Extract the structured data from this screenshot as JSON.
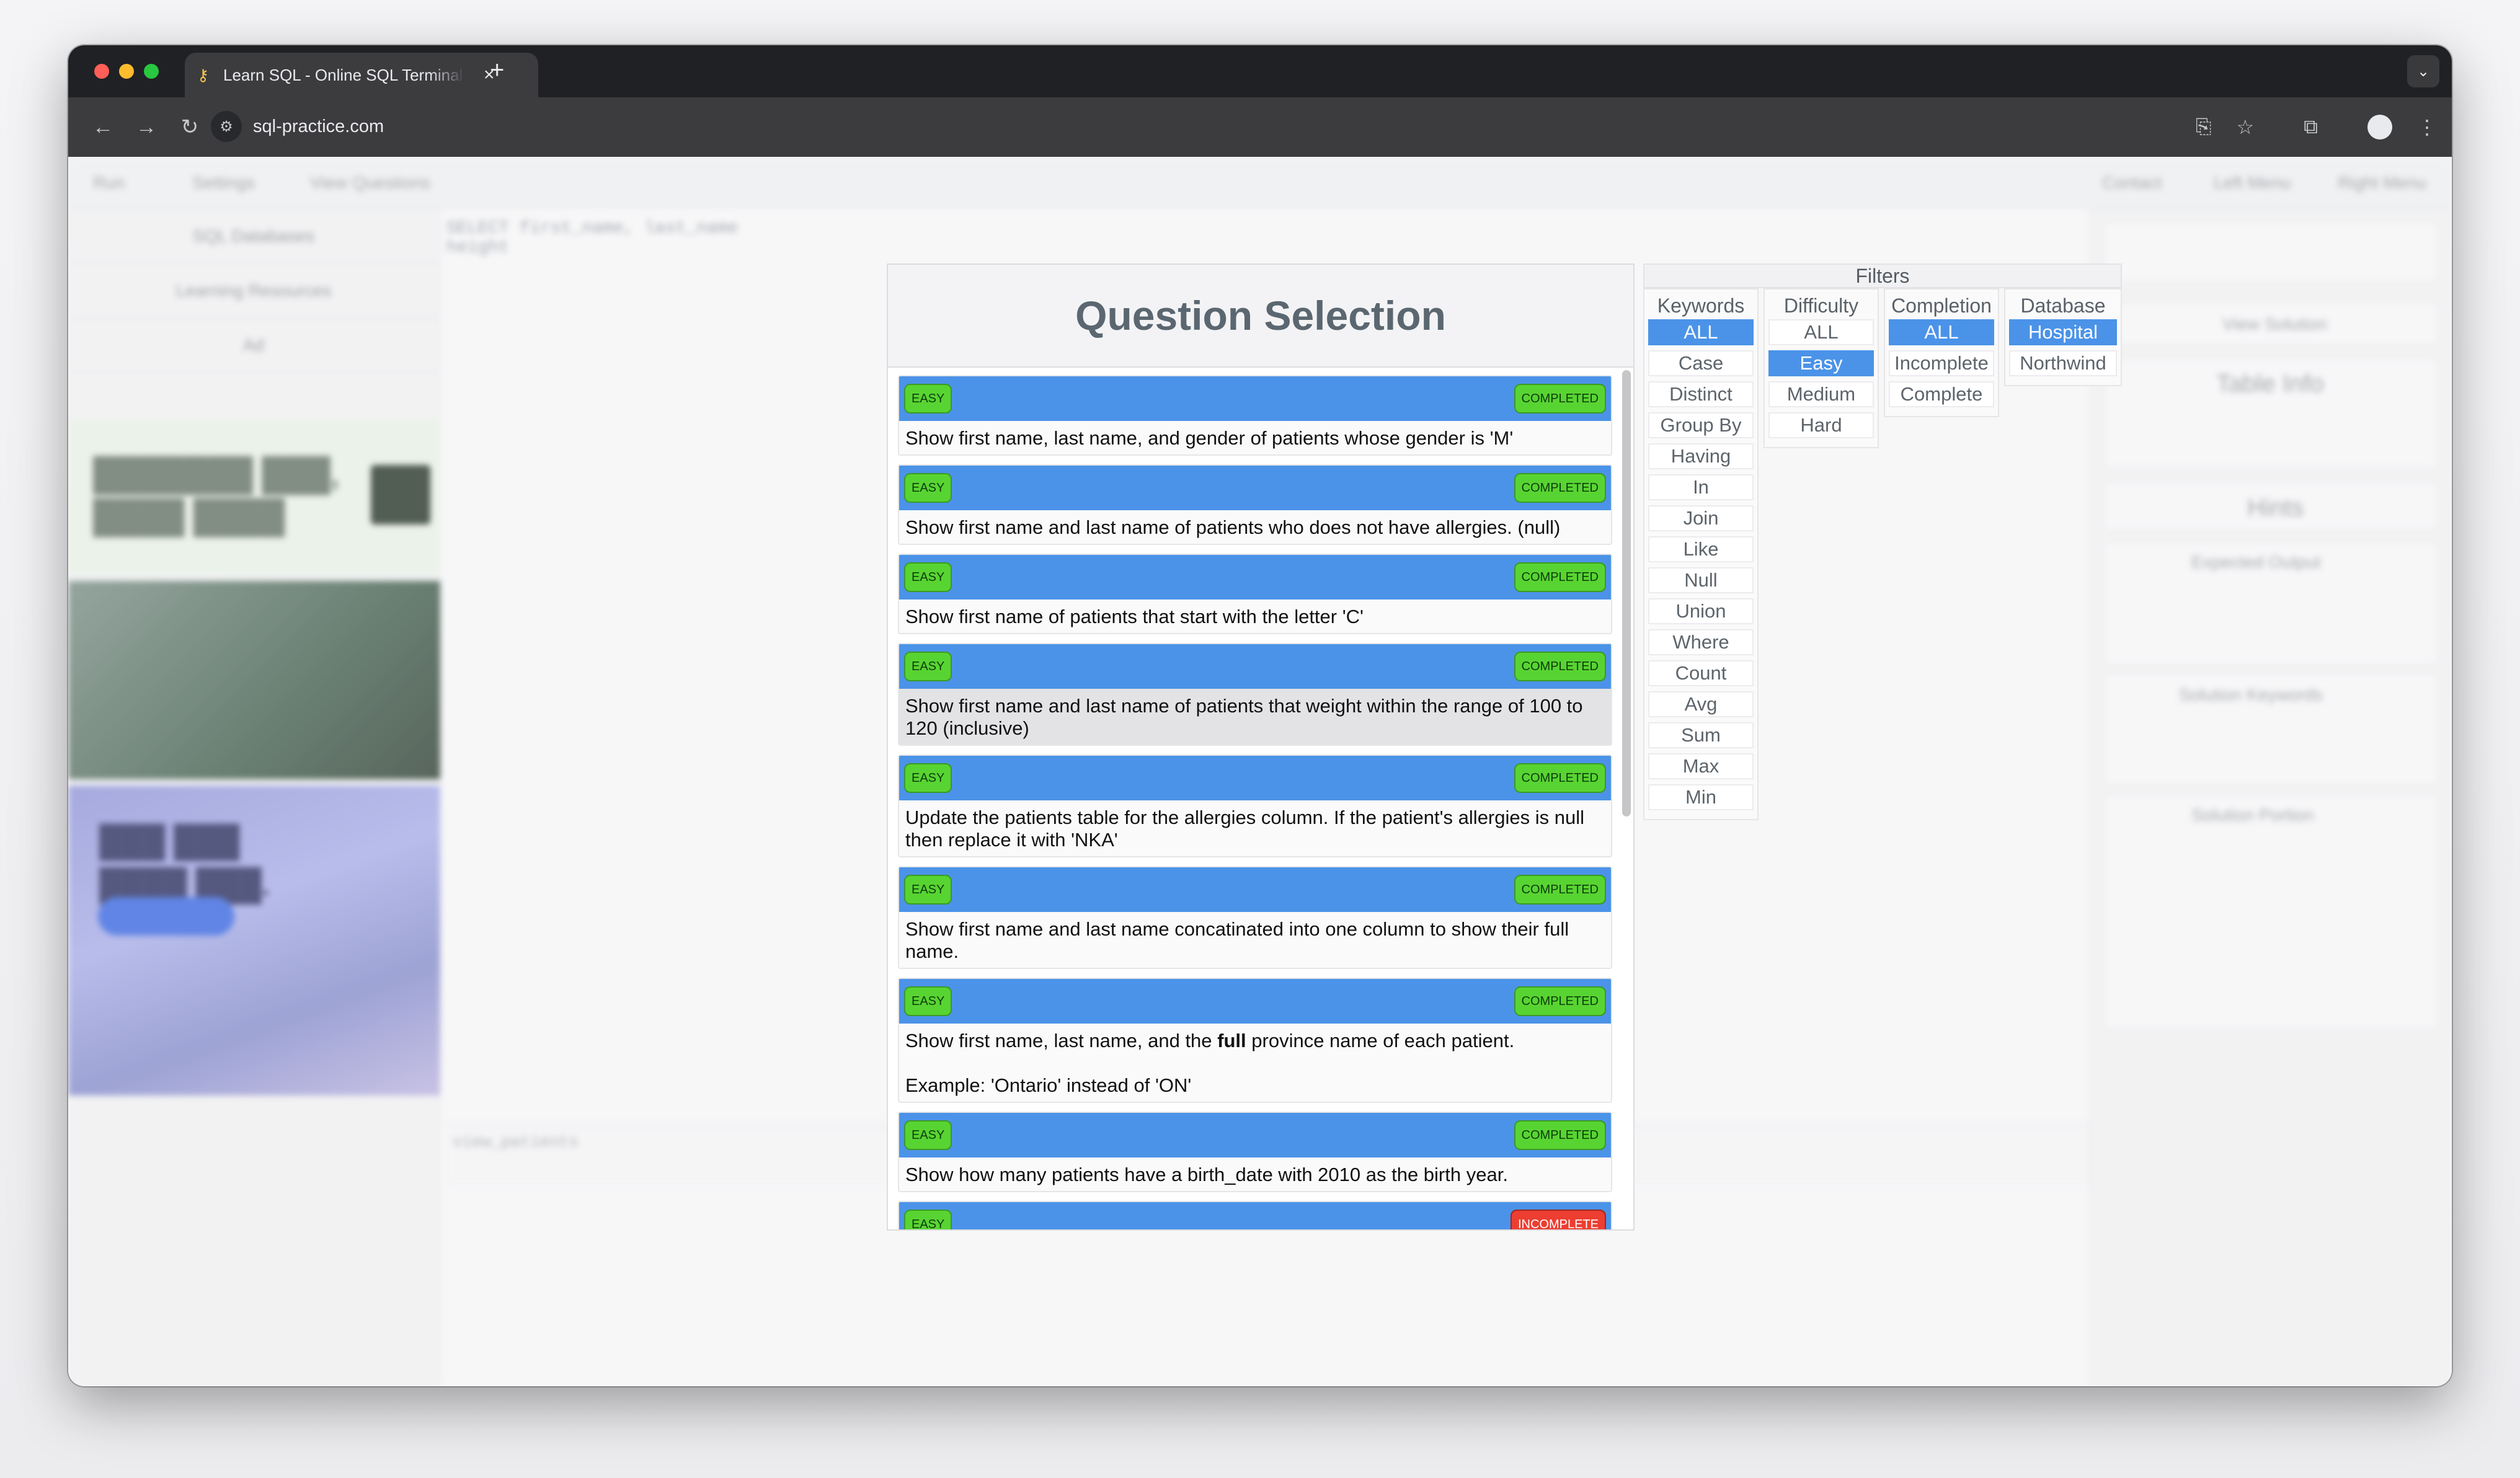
{
  "browser": {
    "tab_title": "Learn SQL - Online SQL Terminal",
    "url": "sql-practice.com",
    "new_tab_label": "+",
    "close_tab_label": "×"
  },
  "modal": {
    "title": "Question Selection",
    "questions": [
      {
        "difficulty": "EASY",
        "status": "COMPLETED",
        "text": "Show first name, last name, and gender of patients whose gender is 'M'"
      },
      {
        "difficulty": "EASY",
        "status": "COMPLETED",
        "text": "Show first name and last name of patients who does not have allergies. (null)"
      },
      {
        "difficulty": "EASY",
        "status": "COMPLETED",
        "text": "Show first name of patients that start with the letter 'C'"
      },
      {
        "difficulty": "EASY",
        "status": "COMPLETED",
        "text": "Show first name and last name of patients that weight within the range of 100 to 120 (inclusive)"
      },
      {
        "difficulty": "EASY",
        "status": "COMPLETED",
        "text": "Update the patients table for the allergies column. If the patient's allergies is null then replace it with 'NKA'"
      },
      {
        "difficulty": "EASY",
        "status": "COMPLETED",
        "text": "Show first name and last name concatinated into one column to show their full name."
      },
      {
        "difficulty": "EASY",
        "status": "COMPLETED",
        "text_before": "Show first name, last name, and the ",
        "text_bold": "full",
        "text_after": " province name of each patient.",
        "example": "Example: 'Ontario' instead of 'ON'"
      },
      {
        "difficulty": "EASY",
        "status": "COMPLETED",
        "text": "Show how many patients have a birth_date with 2010 as the birth year."
      },
      {
        "difficulty": "EASY",
        "status": "INCOMPLETE",
        "text": ""
      }
    ]
  },
  "filters": {
    "title": "Filters",
    "keywords": {
      "label": "Keywords",
      "options": [
        "ALL",
        "Case",
        "Distinct",
        "Group By",
        "Having",
        "In",
        "Join",
        "Like",
        "Null",
        "Union",
        "Where",
        "Count",
        "Avg",
        "Sum",
        "Max",
        "Min"
      ],
      "selected": "ALL"
    },
    "difficulty": {
      "label": "Difficulty",
      "options": [
        "ALL",
        "Easy",
        "Medium",
        "Hard"
      ],
      "selected": "Easy"
    },
    "completion": {
      "label": "Completion",
      "options": [
        "ALL",
        "Incomplete",
        "Complete"
      ],
      "selected": "ALL"
    },
    "database": {
      "label": "Database",
      "options": [
        "Hospital",
        "Northwind"
      ],
      "selected": "Hospital"
    }
  },
  "background": {
    "topbar_items": [
      "Run",
      "Settings",
      "View Questions"
    ],
    "topbar_right": [
      "Contact",
      "Left Menu",
      "Right Menu"
    ],
    "sidebar_items": [
      "SQL Databases",
      "Learning Resources",
      "Ad"
    ],
    "editor_line1": "SELECT first_name, last_name",
    "editor_line2": "height",
    "results_table": "view_patients",
    "right_panel": {
      "view_solution": "View Solution",
      "table_info": "Table Info",
      "hints": "Hints",
      "expected_output": "Expected Output",
      "solution_keywords": "Solution Keywords",
      "solution_portion": "Solution Portion"
    }
  },
  "colors": {
    "accent_blue": "#4b93e8",
    "completed_green": "#58d432",
    "incomplete_red": "#ec3e31"
  }
}
